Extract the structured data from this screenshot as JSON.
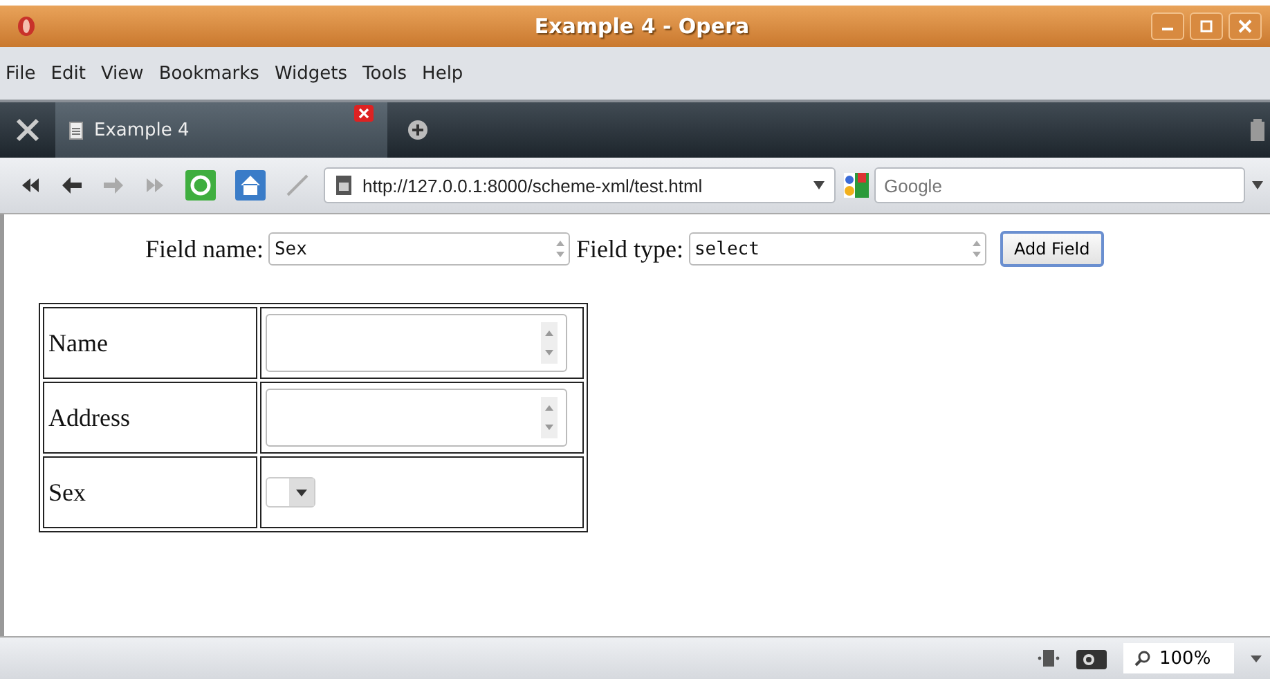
{
  "window": {
    "title": "Example 4 - Opera"
  },
  "menu": [
    {
      "label": "File"
    },
    {
      "label": "Edit"
    },
    {
      "label": "View"
    },
    {
      "label": "Bookmarks"
    },
    {
      "label": "Widgets"
    },
    {
      "label": "Tools"
    },
    {
      "label": "Help"
    }
  ],
  "tabs": [
    {
      "label": "Example 4",
      "selected": true
    }
  ],
  "address_bar": {
    "value": "http://127.0.0.1:8000/scheme-xml/test.html"
  },
  "search": {
    "placeholder": "Google"
  },
  "form": {
    "field_name_label": "Field name:",
    "field_name_value": "Sex",
    "field_type_label": "Field type:",
    "field_type_value": "select",
    "button": "Add Field"
  },
  "table": {
    "rows": [
      {
        "label": "Name",
        "kind": "textarea"
      },
      {
        "label": "Address",
        "kind": "textarea"
      },
      {
        "label": "Sex",
        "kind": "select"
      }
    ]
  },
  "status_bar": {
    "zoom": "100%"
  }
}
